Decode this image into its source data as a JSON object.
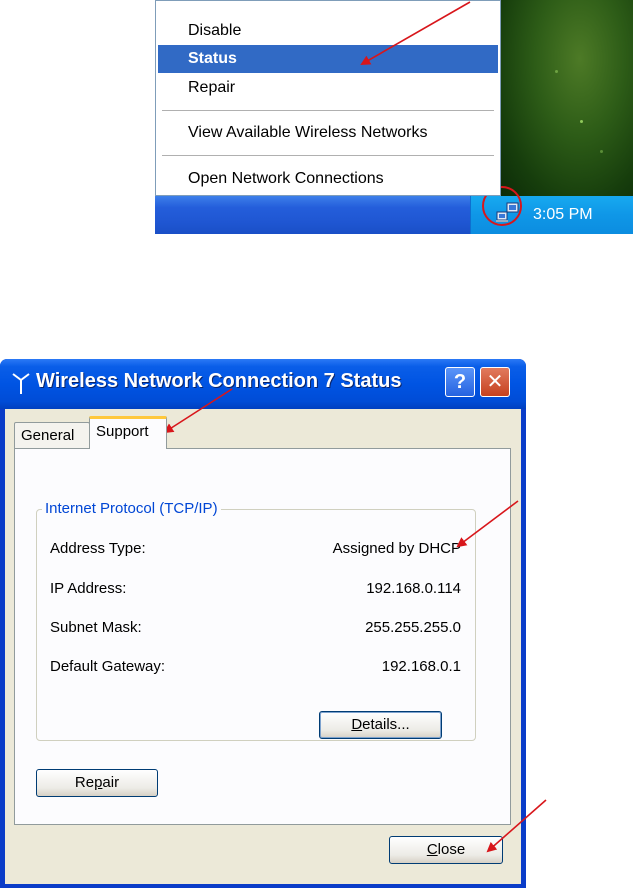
{
  "context_menu": {
    "items": [
      {
        "label": "Disable",
        "selected": false
      },
      {
        "label": "Status",
        "selected": true
      },
      {
        "label": "Repair",
        "selected": false
      },
      {
        "label": "View Available Wireless Networks",
        "selected": false
      },
      {
        "label": "Open Network Connections",
        "selected": false
      }
    ]
  },
  "taskbar": {
    "clock": "3:05 PM",
    "tray_icon": "network-connection-icon"
  },
  "dialog": {
    "title": "Wireless Network Connection 7 Status",
    "title_icon": "wireless-antenna-icon",
    "help_glyph": "?",
    "close_glyph": "✕",
    "tabs": [
      {
        "label": "General",
        "active": false
      },
      {
        "label": "Support",
        "active": true
      }
    ],
    "group_title": "Internet Protocol (TCP/IP)",
    "rows": [
      {
        "label": "Address Type:",
        "value": "Assigned by DHCP"
      },
      {
        "label": "IP Address:",
        "value": "192.168.0.114"
      },
      {
        "label": "Subnet Mask:",
        "value": "255.255.255.0"
      },
      {
        "label": "Default Gateway:",
        "value": "192.168.0.1"
      }
    ],
    "details_button": {
      "pre": "",
      "accel": "D",
      "post": "etails..."
    },
    "repair_button": {
      "pre": "Re",
      "accel": "p",
      "post": "air"
    },
    "close_button": {
      "pre": "",
      "accel": "C",
      "post": "lose"
    }
  },
  "colors": {
    "menu_highlight": "#316ac5",
    "taskbar_blue": "#245edb",
    "tray_blue": "#0f97e7",
    "title_blue": "#0054e3",
    "dialog_face": "#ece9d8",
    "group_title": "#0046d5",
    "annotation_red": "#d8161b"
  }
}
